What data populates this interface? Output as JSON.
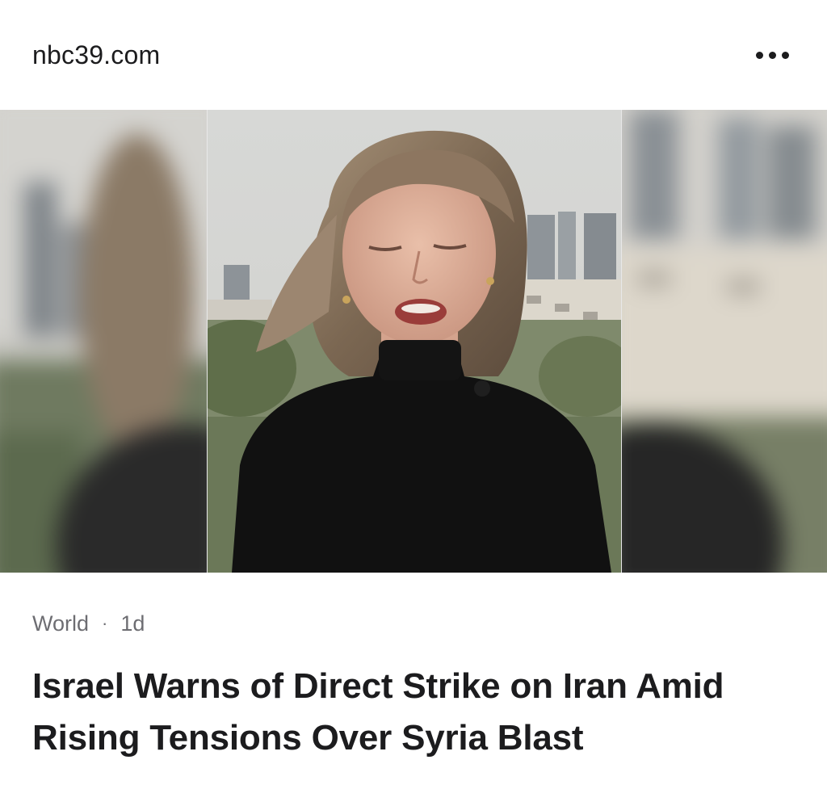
{
  "header": {
    "source": "nbc39.com",
    "more_icon": "ellipsis-icon"
  },
  "hero": {
    "image_description_icon": "news-photo"
  },
  "article": {
    "category": "World",
    "separator": "·",
    "age": "1d",
    "headline": "Israel Warns of Direct Strike on Iran Amid Rising Tensions Over Syria Blast"
  },
  "colors": {
    "text_primary": "#1c1c1e",
    "text_secondary": "#6d6d72",
    "background": "#ffffff"
  }
}
